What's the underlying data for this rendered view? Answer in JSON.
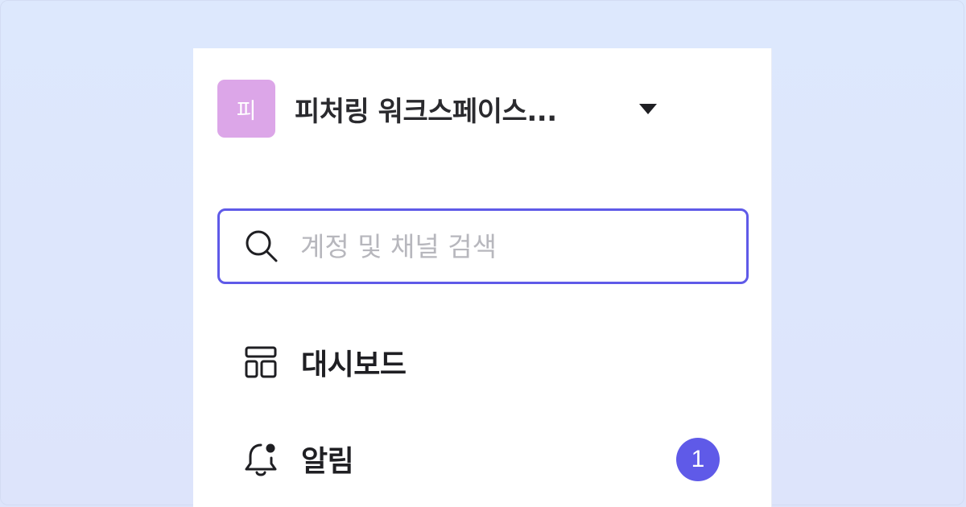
{
  "workspace": {
    "avatar_letter": "피",
    "avatar_color": "#dca6e8",
    "name": "피처링 워크스페이스...",
    "dropdown_icon": "caret-down-icon"
  },
  "search": {
    "placeholder": "계정 및 채널 검색",
    "value": "",
    "icon": "search-icon",
    "border_color": "#5f5ae8"
  },
  "nav": {
    "items": [
      {
        "label": "대시보드",
        "icon": "dashboard-icon"
      },
      {
        "label": "알림",
        "icon": "bell-icon",
        "badge": "1",
        "badge_color": "#5f5ae8"
      }
    ]
  },
  "colors": {
    "background": "#dde8fd",
    "accent": "#5f5ae8"
  }
}
